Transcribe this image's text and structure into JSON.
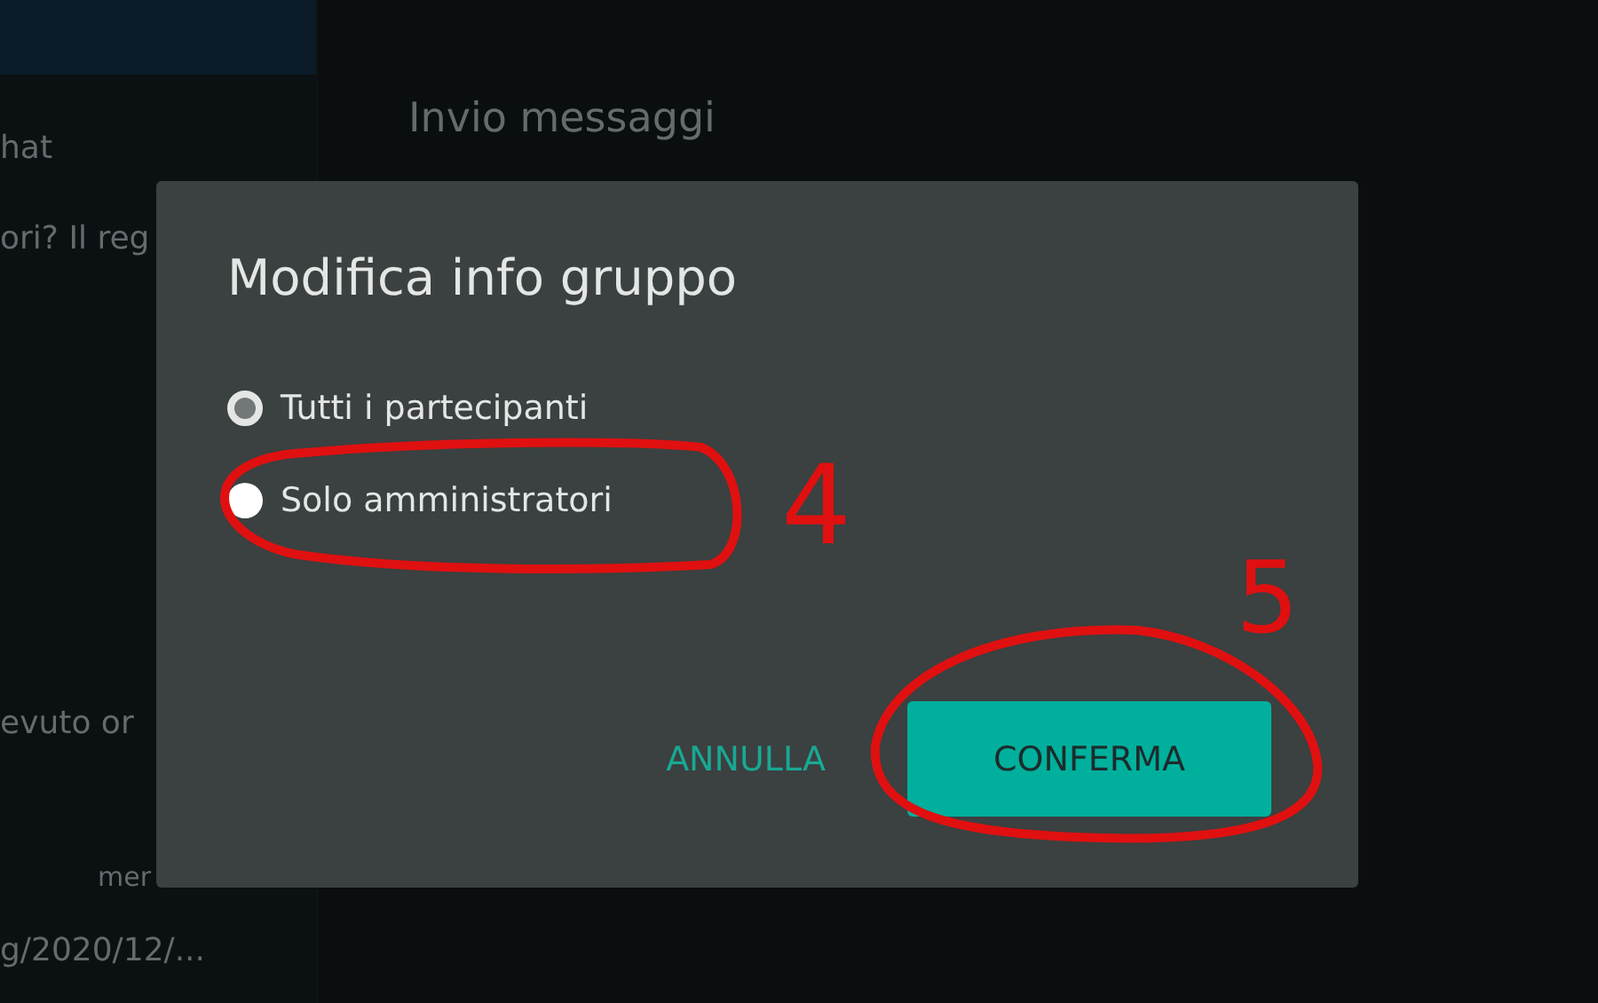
{
  "background": {
    "sidebar_texts": [
      "hat",
      "ori? Il reg",
      "evuto or",
      "mer",
      "g/2020/12/..."
    ],
    "panel_title": "Invio messaggi"
  },
  "dialog": {
    "title": "Modifica info gruppo",
    "options": [
      {
        "label": "Tutti i partecipanti",
        "selected": true
      },
      {
        "label": "Solo amministratori",
        "selected": false
      }
    ],
    "buttons": [
      {
        "label": "ANNULLA",
        "kind": "text"
      },
      {
        "label": "CONFERMA",
        "kind": "filled"
      }
    ]
  },
  "annotations": [
    {
      "label": "4"
    },
    {
      "label": "5"
    }
  ]
}
